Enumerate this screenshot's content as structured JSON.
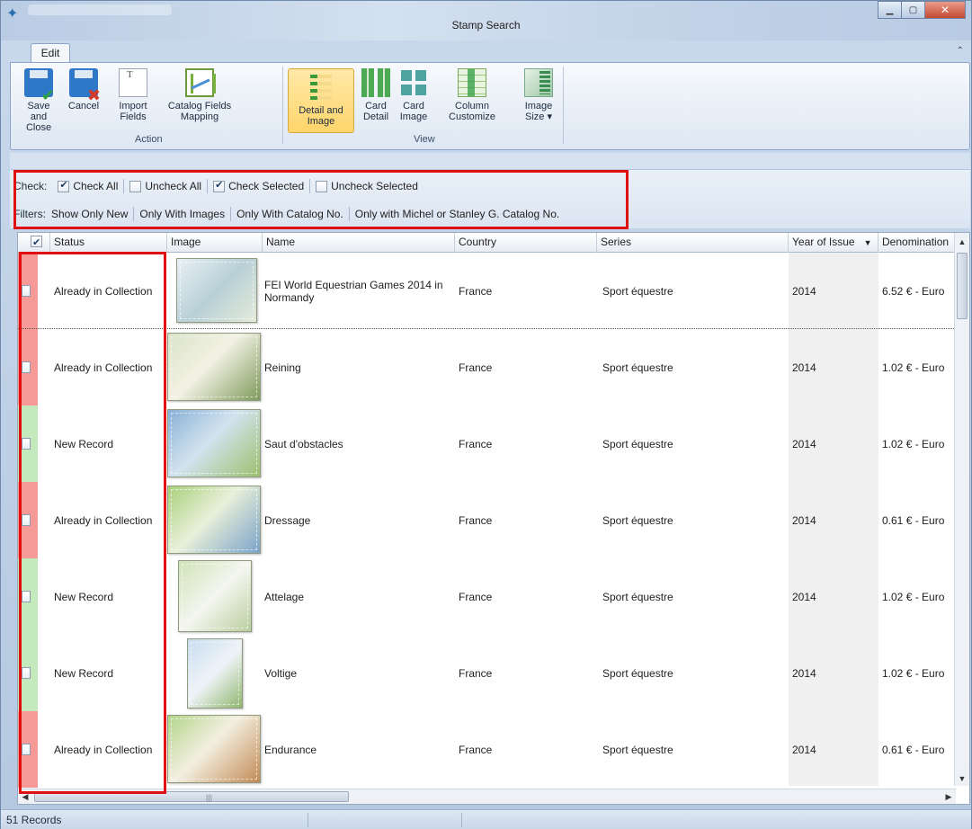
{
  "window": {
    "title": "Stamp Search"
  },
  "ribbon": {
    "tab": "Edit",
    "groups": {
      "action": "Action",
      "view": "View"
    },
    "buttons": {
      "save_close": [
        "Save and",
        "Close"
      ],
      "cancel": [
        "Cancel"
      ],
      "import_fields": [
        "Import",
        "Fields"
      ],
      "catalog_mapping": [
        "Catalog Fields",
        "Mapping"
      ],
      "detail_image": [
        "Detail and",
        "Image"
      ],
      "card_detail": [
        "Card",
        "Detail"
      ],
      "card_image": [
        "Card",
        "Image"
      ],
      "column_customize": [
        "Column",
        "Customize"
      ],
      "image_size": [
        "Image",
        "Size ▾"
      ]
    }
  },
  "check_bar": {
    "label": "Check:",
    "check_all": "Check All",
    "uncheck_all": "Uncheck All",
    "check_selected": "Check Selected",
    "uncheck_selected": "Uncheck Selected"
  },
  "filter_bar": {
    "label": "Filters:",
    "show_only_new": "Show Only New",
    "only_with_images": "Only With Images",
    "only_with_catalog": "Only With Catalog No.",
    "only_michel_stanley": "Only with Michel or Stanley G. Catalog No."
  },
  "grid": {
    "columns": [
      "Status",
      "Image",
      "Name",
      "Country",
      "Series",
      "Year of Issue",
      "Denomination"
    ],
    "sorted_column": "Year of Issue",
    "colors": {
      "already": "#f59a96",
      "new": "#c3e9bd"
    },
    "rows": [
      {
        "status": "Already in Collection",
        "state": "already",
        "name": "FEI World Equestrian Games 2014 in Normandy",
        "country": "France",
        "series": "Sport équestre",
        "year": "2014",
        "denomination": "6.52 € - Euro"
      },
      {
        "status": "Already in Collection",
        "state": "already",
        "name": "Reining",
        "country": "France",
        "series": "Sport équestre",
        "year": "2014",
        "denomination": "1.02 € - Euro"
      },
      {
        "status": "New Record",
        "state": "new",
        "name": "Saut d'obstacles",
        "country": "France",
        "series": "Sport équestre",
        "year": "2014",
        "denomination": "1.02 € - Euro"
      },
      {
        "status": "Already in Collection",
        "state": "already",
        "name": "Dressage",
        "country": "France",
        "series": "Sport équestre",
        "year": "2014",
        "denomination": "0.61 € - Euro"
      },
      {
        "status": "New Record",
        "state": "new",
        "name": "Attelage",
        "country": "France",
        "series": "Sport équestre",
        "year": "2014",
        "denomination": "1.02 € - Euro"
      },
      {
        "status": "New Record",
        "state": "new",
        "name": "Voltige",
        "country": "France",
        "series": "Sport équestre",
        "year": "2014",
        "denomination": "1.02 € - Euro"
      },
      {
        "status": "Already in Collection",
        "state": "already",
        "name": "Endurance",
        "country": "France",
        "series": "Sport équestre",
        "year": "2014",
        "denomination": "0.61 € - Euro"
      }
    ]
  },
  "status_bar": {
    "records": "51 Records"
  }
}
